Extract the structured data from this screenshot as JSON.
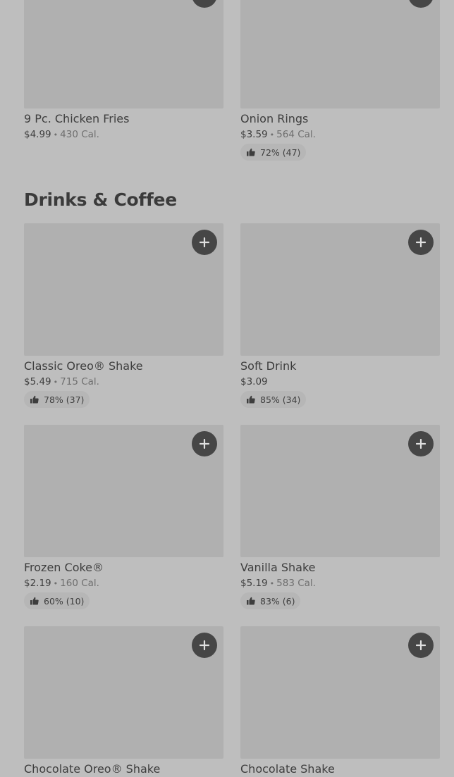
{
  "sections": {
    "drinks_title": "Drinks & Coffee"
  },
  "items": {
    "chicken_fries": {
      "name": "9 Pc. Chicken Fries",
      "price": "$4.99",
      "calories": "430 Cal."
    },
    "onion_rings": {
      "name": "Onion Rings",
      "price": "$3.59",
      "calories": "564 Cal.",
      "rating": "72% (47)"
    },
    "classic_oreo_shake": {
      "name": "Classic Oreo® Shake",
      "price": "$5.49",
      "calories": "715 Cal.",
      "rating": "78% (37)"
    },
    "soft_drink": {
      "name": "Soft Drink",
      "price": "$3.09",
      "rating": "85% (34)"
    },
    "frozen_coke": {
      "name": "Frozen Coke®",
      "price": "$2.19",
      "calories": "160 Cal.",
      "rating": "60% (10)"
    },
    "vanilla_shake": {
      "name": "Vanilla Shake",
      "price": "$5.19",
      "calories": "583 Cal.",
      "rating": "83% (6)"
    },
    "chocolate_oreo_shake": {
      "name": "Chocolate Oreo® Shake"
    },
    "chocolate_shake": {
      "name": "Chocolate Shake"
    }
  },
  "separator": "•",
  "icons": {
    "add": "plus-icon",
    "rating": "thumbs-up-icon"
  },
  "colors": {
    "background": "#bebebe",
    "image_placeholder": "#b0b0b0",
    "add_button": "#464646",
    "rating_pill": "#b6b6b6"
  }
}
